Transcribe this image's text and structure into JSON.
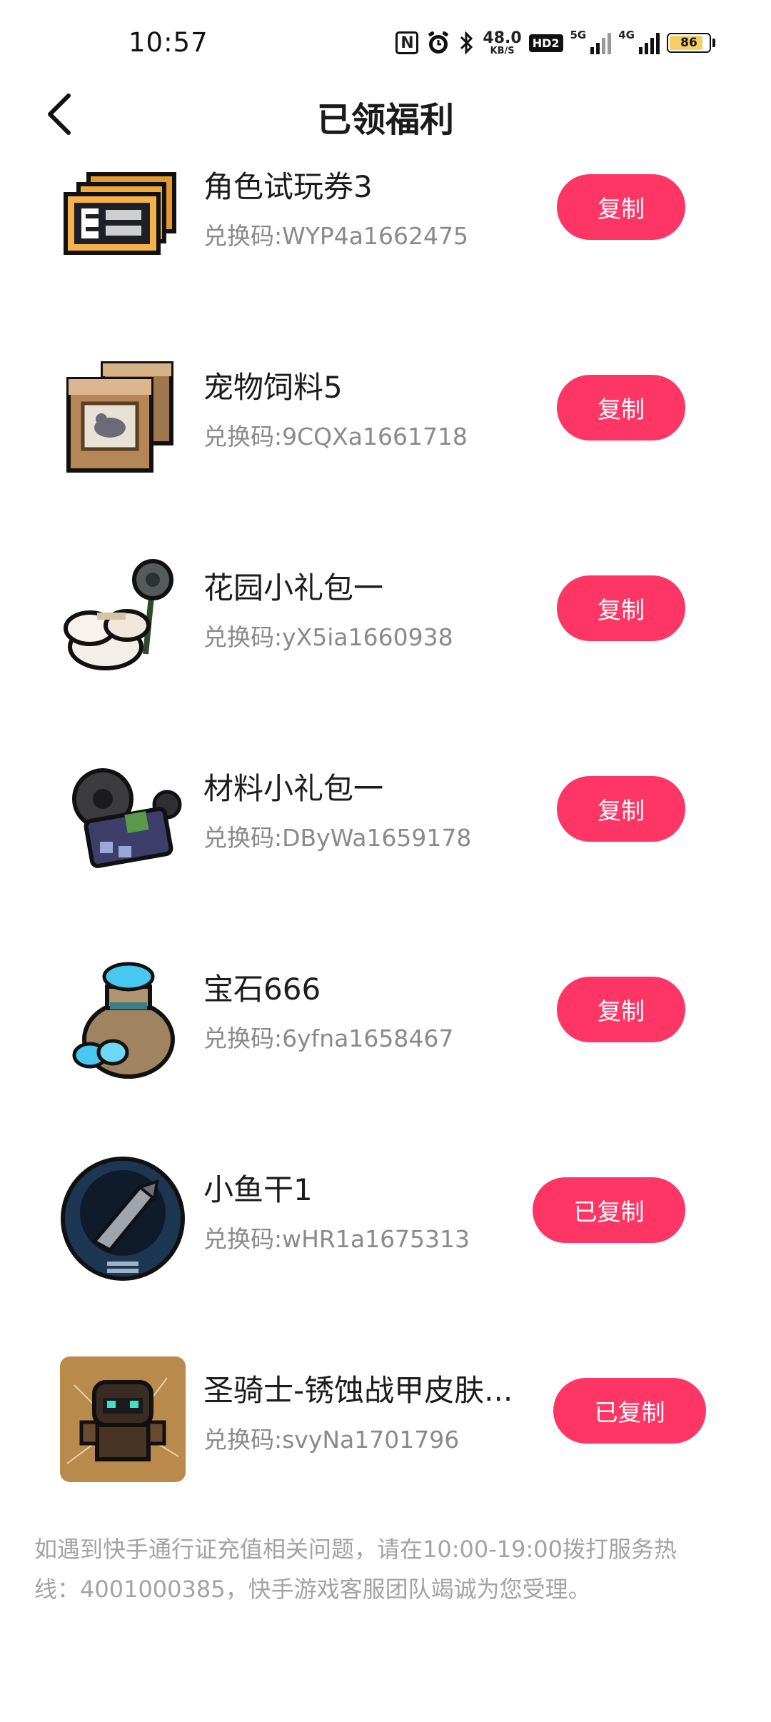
{
  "status_bar": {
    "time": "10:57",
    "nfc": "N",
    "net_speed_value": "48.0",
    "net_speed_unit": "KB/S",
    "hd_label": "HD2",
    "net1": "5G",
    "net2": "4G",
    "battery": "86"
  },
  "header": {
    "title": "已领福利"
  },
  "items": [
    {
      "name": "角色试玩券3",
      "code": "兑换码:WYP4a1662475",
      "button": "复制",
      "icon": "trial-ticket-icon"
    },
    {
      "name": "宠物饲料5",
      "code": "兑换码:9CQXa1661718",
      "button": "复制",
      "icon": "pet-food-icon"
    },
    {
      "name": "花园小礼包一",
      "code": "兑换码:yX5ia1660938",
      "button": "复制",
      "icon": "garden-gift-icon"
    },
    {
      "name": "材料小礼包一",
      "code": "兑换码:DByWa1659178",
      "button": "复制",
      "icon": "material-gift-icon"
    },
    {
      "name": "宝石666",
      "code": "兑换码:6yfna1658467",
      "button": "复制",
      "icon": "gem-bag-icon"
    },
    {
      "name": "小鱼干1",
      "code": "兑换码:wHR1a1675313",
      "button": "已复制",
      "icon": "dried-fish-icon"
    },
    {
      "name": "圣骑士-锈蚀战甲皮肤...",
      "code": "兑换码:svyNa1701796",
      "button": "已复制",
      "icon": "paladin-skin-icon"
    }
  ],
  "footer": {
    "text": "如遇到快手通行证充值相关问题，请在10:00-19:00拨打服务热线：4001000385，快手游戏客服团队竭诚为您受理。"
  },
  "colors": {
    "accent": "#fe3666",
    "text": "#1c1c1c",
    "muted": "#8a8a8a"
  }
}
